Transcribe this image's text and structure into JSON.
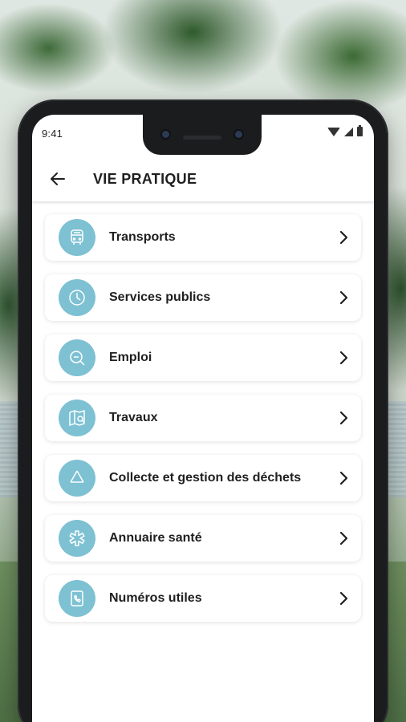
{
  "status_bar": {
    "time": "9:41"
  },
  "app_bar": {
    "title": "VIE PRATIQUE",
    "back_icon": "arrow-left-icon"
  },
  "menu": {
    "accent_color": "#7dc1d3",
    "items": [
      {
        "label": "Transports",
        "icon": "bus-icon"
      },
      {
        "label": "Services publics",
        "icon": "clock-icon"
      },
      {
        "label": "Emploi",
        "icon": "job-search-icon"
      },
      {
        "label": "Travaux",
        "icon": "map-search-icon"
      },
      {
        "label": "Collecte et gestion des déchets",
        "icon": "recycle-icon"
      },
      {
        "label": "Annuaire santé",
        "icon": "medical-star-icon"
      },
      {
        "label": "Numéros utiles",
        "icon": "phone-book-icon"
      }
    ]
  }
}
